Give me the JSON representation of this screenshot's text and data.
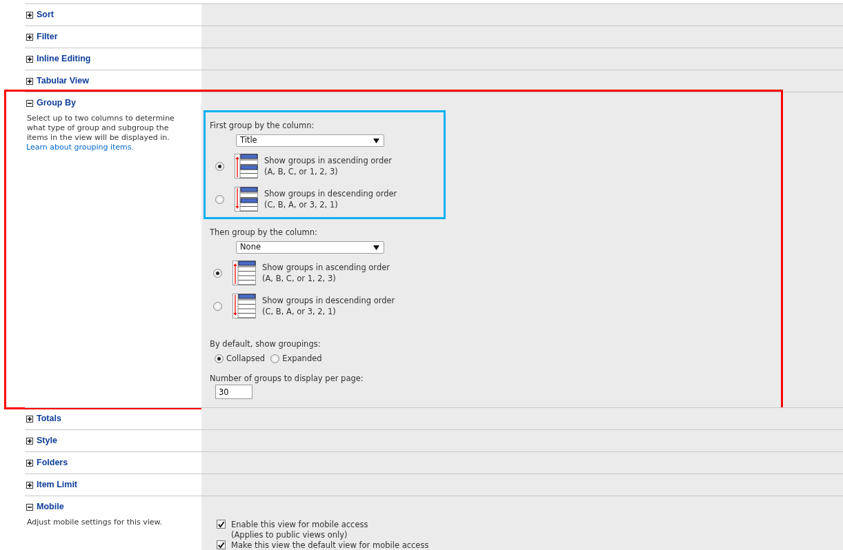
{
  "sections": [
    {
      "title": "Sort",
      "expanded": false
    },
    {
      "title": "Filter",
      "expanded": false
    },
    {
      "title": "Inline Editing",
      "expanded": false
    },
    {
      "title": "Tabular View",
      "expanded": false
    },
    {
      "title": "Group By",
      "expanded": true,
      "highlighted": true,
      "kind": "group_by",
      "description": "Select up to two columns to determine what type of group and subgroup the items in the view will be displayed in.",
      "link": "Learn about grouping items.",
      "groups": [
        {
          "kind": "first",
          "label": "First group by the column:",
          "value": "Title",
          "highlighted": true,
          "orders": [
            {
              "kind": "ascending",
              "text": "Show groups in ascending order",
              "example": "(A, B, C, or 1, 2, 3)",
              "selected": true
            },
            {
              "kind": "descending",
              "text": "Show groups in descending order",
              "example": "(C, B, A, or 3, 2, 1)",
              "selected": false
            }
          ]
        },
        {
          "kind": "then",
          "label": "Then group by the column:",
          "value": "None",
          "orders": [
            {
              "kind": "ascending",
              "text": "Show groups in ascending order",
              "example": "(A, B, C, or 1, 2, 3)",
              "selected": true
            },
            {
              "kind": "descending",
              "text": "Show groups in descending order",
              "example": "(C, B, A, or 3, 2, 1)",
              "selected": false
            }
          ]
        }
      ],
      "default_display": {
        "label": "By default, show groupings:",
        "options": [
          {
            "label": "Collapsed",
            "selected": true
          },
          {
            "label": "Expanded",
            "selected": false
          }
        ]
      },
      "per_page": {
        "label": "Number of groups to display per page:",
        "value": "30"
      }
    },
    {
      "title": "Totals",
      "expanded": false
    },
    {
      "title": "Style",
      "expanded": false
    },
    {
      "title": "Folders",
      "expanded": false
    },
    {
      "title": "Item Limit",
      "expanded": false
    },
    {
      "title": "Mobile",
      "expanded": true,
      "kind": "mobile",
      "description": "Adjust mobile settings for this view.",
      "options": [
        {
          "label": "Enable this view for mobile access",
          "note": "(Applies to public views only)",
          "checked": true
        },
        {
          "label": "Make this view the default view for mobile access",
          "checked": true
        }
      ]
    }
  ]
}
